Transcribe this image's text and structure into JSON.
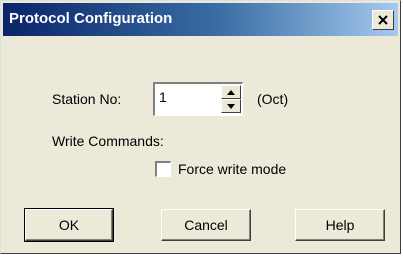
{
  "window": {
    "title": "Protocol Configuration",
    "close_glyph": "×"
  },
  "station": {
    "label": "Station No:",
    "value": "1",
    "unit": "(Oct)"
  },
  "write_commands": {
    "label": "Write Commands:",
    "force_write_label": "Force write mode",
    "force_write_checked": false
  },
  "buttons": {
    "ok": "OK",
    "cancel": "Cancel",
    "help": "Help"
  },
  "icons": {
    "close": "close-icon",
    "spin_up": "arrow-up-icon",
    "spin_down": "arrow-down-icon"
  },
  "colors": {
    "dialog_face": "#ece9d8",
    "title_start": "#0a246a",
    "title_end": "#a6caf0"
  }
}
